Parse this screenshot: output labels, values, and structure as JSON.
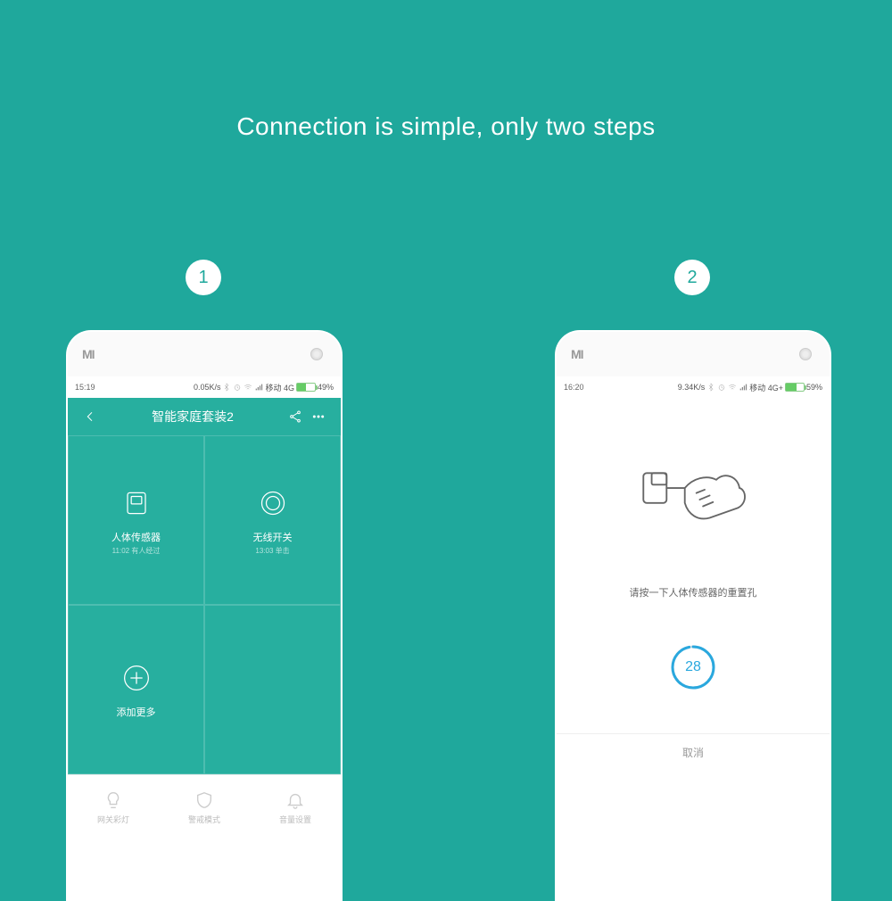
{
  "headline": "Connection is simple, only two steps",
  "steps": {
    "one": "1",
    "two": "2"
  },
  "phone_brand": "MI",
  "phone1": {
    "status": {
      "time": "15:19",
      "net_speed": "0.05K/s",
      "carrier": "移动 4G",
      "battery_pct": "49%",
      "battery_fill": 49
    },
    "header_title": "智能家庭套装2",
    "tiles": {
      "sensor": {
        "title": "人体传感器",
        "sub": "11:02 有人经过"
      },
      "switch": {
        "title": "无线开关",
        "sub": "13:03 单击"
      },
      "add": {
        "title": "添加更多"
      }
    },
    "bottom": {
      "light": "网关彩灯",
      "alert": "警戒模式",
      "volume": "音量设置"
    }
  },
  "phone2": {
    "status": {
      "time": "16:20",
      "net_speed": "9.34K/s",
      "carrier": "移动 4G+",
      "battery_pct": "59%",
      "battery_fill": 59
    },
    "instruction": "请按一下人体传感器的重置孔",
    "countdown": "28",
    "cancel": "取消"
  }
}
